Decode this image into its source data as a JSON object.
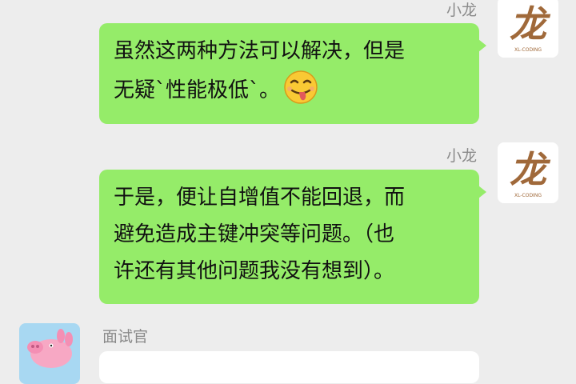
{
  "messages": [
    {
      "sender": "小龙",
      "lines": [
        "虽然这两种方法可以解决，但是",
        "无疑`性能极低`。"
      ],
      "emoji": "face-with-tongue-emoji",
      "side": "right"
    },
    {
      "sender": "小龙",
      "lines": [
        "于是，便让自增值不能回退，而",
        "避免造成主键冲突等问题。（也",
        "许还有其他问题我没有想到）。"
      ],
      "side": "right"
    },
    {
      "sender": "面试官",
      "lines": [],
      "side": "left"
    }
  ],
  "avatars": {
    "xiaolong": {
      "glyph": "龙",
      "caption": "XL-CODING",
      "icon": "dragon-logo-avatar"
    },
    "interviewer": {
      "icon": "peppa-pig-avatar"
    }
  },
  "colors": {
    "background": "#ededed",
    "my_bubble": "#95ec69",
    "their_bubble": "#ffffff",
    "sender_name": "#8a8a8a",
    "logo_brown": "#a0693a"
  }
}
